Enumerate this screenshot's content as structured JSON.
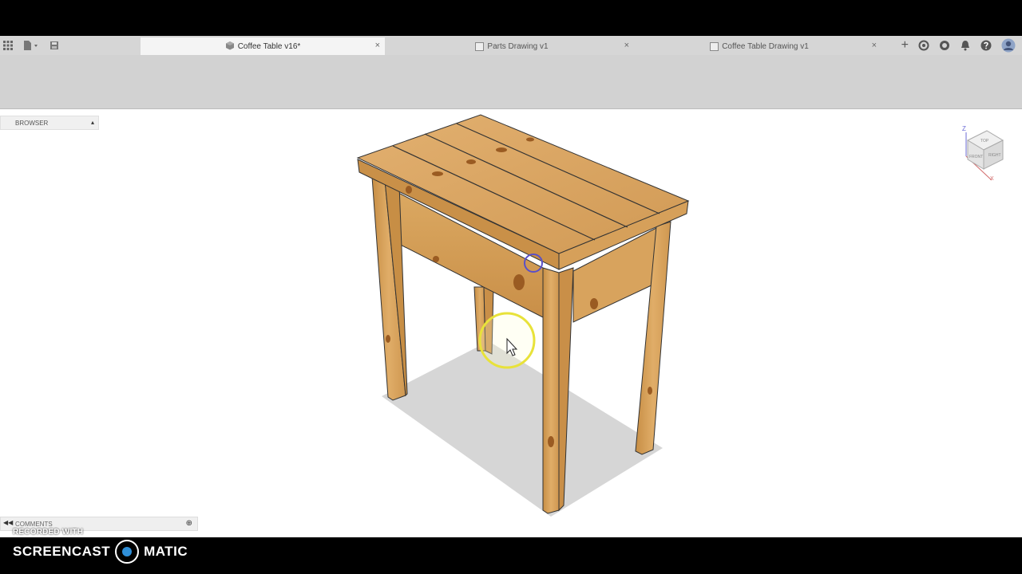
{
  "tabs": [
    {
      "label": "Coffee Table v16*",
      "active": true
    },
    {
      "label": "Parts Drawing v1",
      "active": false
    },
    {
      "label": "Coffee Table Drawing v1",
      "active": false
    }
  ],
  "tab_close_glyph": "×",
  "new_tab_glyph": "+",
  "browser": {
    "label": "BROWSER"
  },
  "comments": {
    "label": "COMMENTS"
  },
  "viewcube": {
    "top": "TOP",
    "front": "FRONT",
    "right": "RIGHT",
    "z_axis": "Z",
    "x_axis": "X"
  },
  "watermark": {
    "recorded_with": "RECORDED WITH",
    "brand_left": "SCREENCAST",
    "brand_right": "MATIC"
  },
  "colors": {
    "wood": "#d9a65f",
    "wood_dark": "#b77f3a",
    "shadow": "#d4d4d4",
    "cursor_highlight": "#e8e23a",
    "select_ring": "#5a4fc8"
  },
  "icons": [
    "app-grid-icon",
    "file-menu-icon",
    "save-icon",
    "add-tab-icon",
    "extensions-icon",
    "job-status-icon",
    "notifications-icon",
    "help-icon",
    "user-avatar-icon"
  ]
}
